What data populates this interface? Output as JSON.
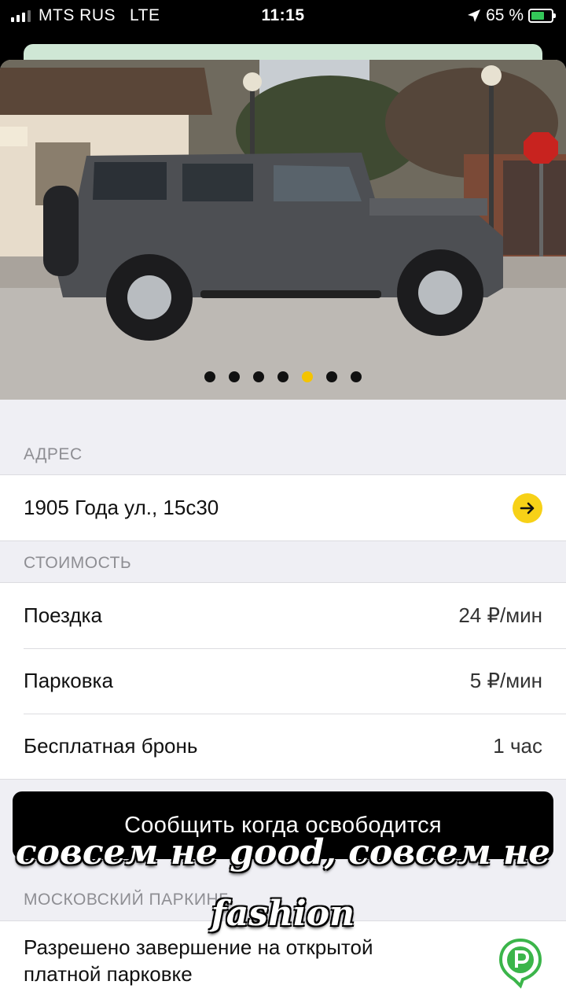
{
  "status_bar": {
    "carrier": "MTS RUS",
    "network": "LTE",
    "time": "11:15",
    "battery_percent": "65 %",
    "battery_level": 0.65
  },
  "gallery": {
    "photo_count": 7,
    "active_index": 4,
    "colors": {
      "active_dot": "#f4c400",
      "dot": "#111111"
    }
  },
  "address": {
    "header": "АДРЕС",
    "value": "1905 Года ул., 15с30",
    "action_icon": "arrow-right-icon"
  },
  "cost": {
    "header": "СТОИМОСТЬ",
    "rows": [
      {
        "label": "Поездка",
        "value": "24 ₽/мин"
      },
      {
        "label": "Парковка",
        "value": "5 ₽/мин"
      },
      {
        "label": "Бесплатная бронь",
        "value": "1 час"
      }
    ]
  },
  "notify_button": {
    "label": "Сообщить когда освободится"
  },
  "moscow_parking": {
    "header": "МОСКОВСКИЙ ПАРКИНГ",
    "text": "Разрешено завершение на открытой платной парковке",
    "icon": "parking-pin-icon",
    "icon_color": "#3bb54a"
  },
  "overlay_caption": {
    "line1": "совсем не good, совсем не",
    "line2": "fashion"
  }
}
